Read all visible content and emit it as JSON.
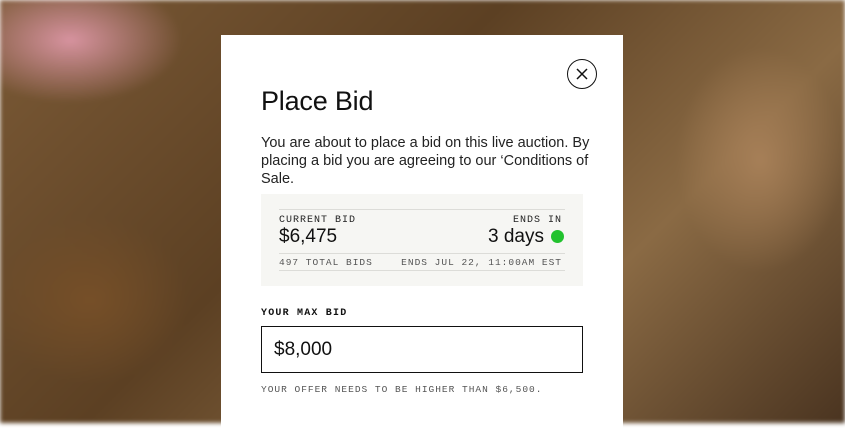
{
  "modal": {
    "title": "Place Bid",
    "description": "You are about to place a bid on this live auction. By placing a bid you are agreeing to our ‘Conditions of Sale.",
    "close_icon": "close-icon"
  },
  "bid_info": {
    "current_bid_label": "CURRENT BID",
    "current_bid_value": "$6,475",
    "ends_in_label": "ENDS IN",
    "ends_in_value": "3 days",
    "status_color": "#22c22e",
    "total_bids": "497 TOTAL BIDS",
    "ends_date": "ENDS JUL 22, 11:00AM EST"
  },
  "max_bid": {
    "label": "YOUR MAX BID",
    "value": "$8,000",
    "hint": "YOUR OFFER NEEDS TO BE HIGHER THAN $6,500."
  }
}
